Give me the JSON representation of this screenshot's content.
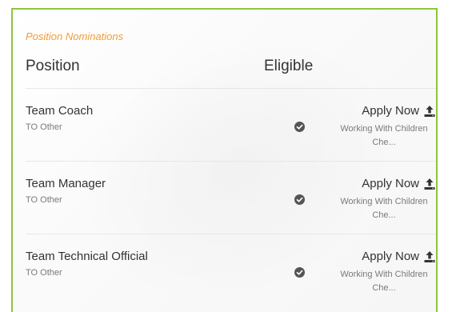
{
  "panel": {
    "title": "Position Nominations"
  },
  "table": {
    "headers": {
      "position": "Position",
      "eligible": "Eligible"
    },
    "rows": [
      {
        "position": "Team Coach",
        "category": "TO Other",
        "eligible": true,
        "action": "Apply Now",
        "requirement_line1": "Working With Children",
        "requirement_line2": "Che..."
      },
      {
        "position": "Team Manager",
        "category": "TO Other",
        "eligible": true,
        "action": "Apply Now",
        "requirement_line1": "Working With Children",
        "requirement_line2": "Che..."
      },
      {
        "position": "Team Technical Official",
        "category": "TO Other",
        "eligible": true,
        "action": "Apply Now",
        "requirement_line1": "Working With Children",
        "requirement_line2": "Che..."
      }
    ]
  },
  "icons": {
    "eligible": "check-circle-icon",
    "apply": "upload-icon"
  },
  "colors": {
    "border": "#8cc63f",
    "title": "#f39c34",
    "text": "#333333",
    "muted": "#7a7a7a",
    "divider": "#e3e8ec",
    "check": "#555555"
  }
}
